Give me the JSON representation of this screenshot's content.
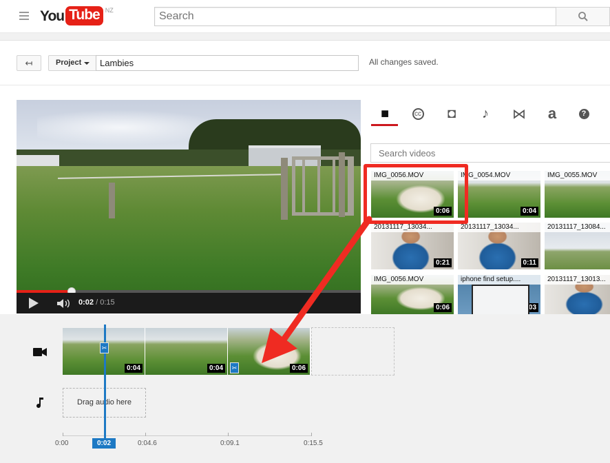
{
  "masthead": {
    "logo_you": "You",
    "logo_tube": "Tube",
    "region": "NZ",
    "search_placeholder": "Search",
    "icons": [
      "menu-icon",
      "search-icon"
    ]
  },
  "editor": {
    "project_button": "Project",
    "project_title": "Lambies",
    "save_status": "All changes saved."
  },
  "player": {
    "time_current": "0:02",
    "time_separator": " / ",
    "time_total": "0:15",
    "progress_fraction": 0.16
  },
  "panel": {
    "tabs": [
      {
        "name": "tab-videos",
        "icon": "video-camera-icon",
        "glyph": "■",
        "active": true
      },
      {
        "name": "tab-captions",
        "icon": "cc-icon",
        "glyph": "cc"
      },
      {
        "name": "tab-photos",
        "icon": "camera-icon",
        "glyph": "◘"
      },
      {
        "name": "tab-audio",
        "icon": "music-note-icon",
        "glyph": "♪"
      },
      {
        "name": "tab-transitions",
        "icon": "transition-icon",
        "glyph": "⋈"
      },
      {
        "name": "tab-text",
        "icon": "text-icon",
        "glyph": "a"
      },
      {
        "name": "tab-help",
        "icon": "help-icon",
        "glyph": "?"
      }
    ],
    "search_placeholder": "Search videos",
    "thumbnails": [
      {
        "title": "IMG_0056.MOV",
        "duration": "0:06",
        "bg": "lamb"
      },
      {
        "title": "IMG_0054.MOV",
        "duration": "0:04",
        "bg": "grass"
      },
      {
        "title": "IMG_0055.MOV",
        "duration": "",
        "bg": "grass"
      },
      {
        "title": "20131117_13034...",
        "duration": "0:21",
        "bg": "person"
      },
      {
        "title": "20131117_13034...",
        "duration": "0:11",
        "bg": "person"
      },
      {
        "title": "20131117_13084...",
        "duration": "",
        "bg": "castle"
      },
      {
        "title": "IMG_0056.MOV",
        "duration": "0:06",
        "bg": "lamb"
      },
      {
        "title": "iphone find setup....",
        "duration": "0:03",
        "bg": "phone"
      },
      {
        "title": "20131117_13013...",
        "duration": "",
        "bg": "person"
      }
    ]
  },
  "timeline": {
    "clips": [
      {
        "duration": "0:04",
        "bg": "grass"
      },
      {
        "duration": "0:04",
        "bg": "grass"
      },
      {
        "duration": "0:06",
        "bg": "lamb"
      }
    ],
    "audio_drop_label": "Drag audio here",
    "ruler": [
      "0:00",
      "0:04.6",
      "0:09.1",
      "0:15.5"
    ],
    "playhead_label": "0:02",
    "trim_glyph": "✂"
  },
  "annotation": {
    "color": "#ef2b22"
  }
}
